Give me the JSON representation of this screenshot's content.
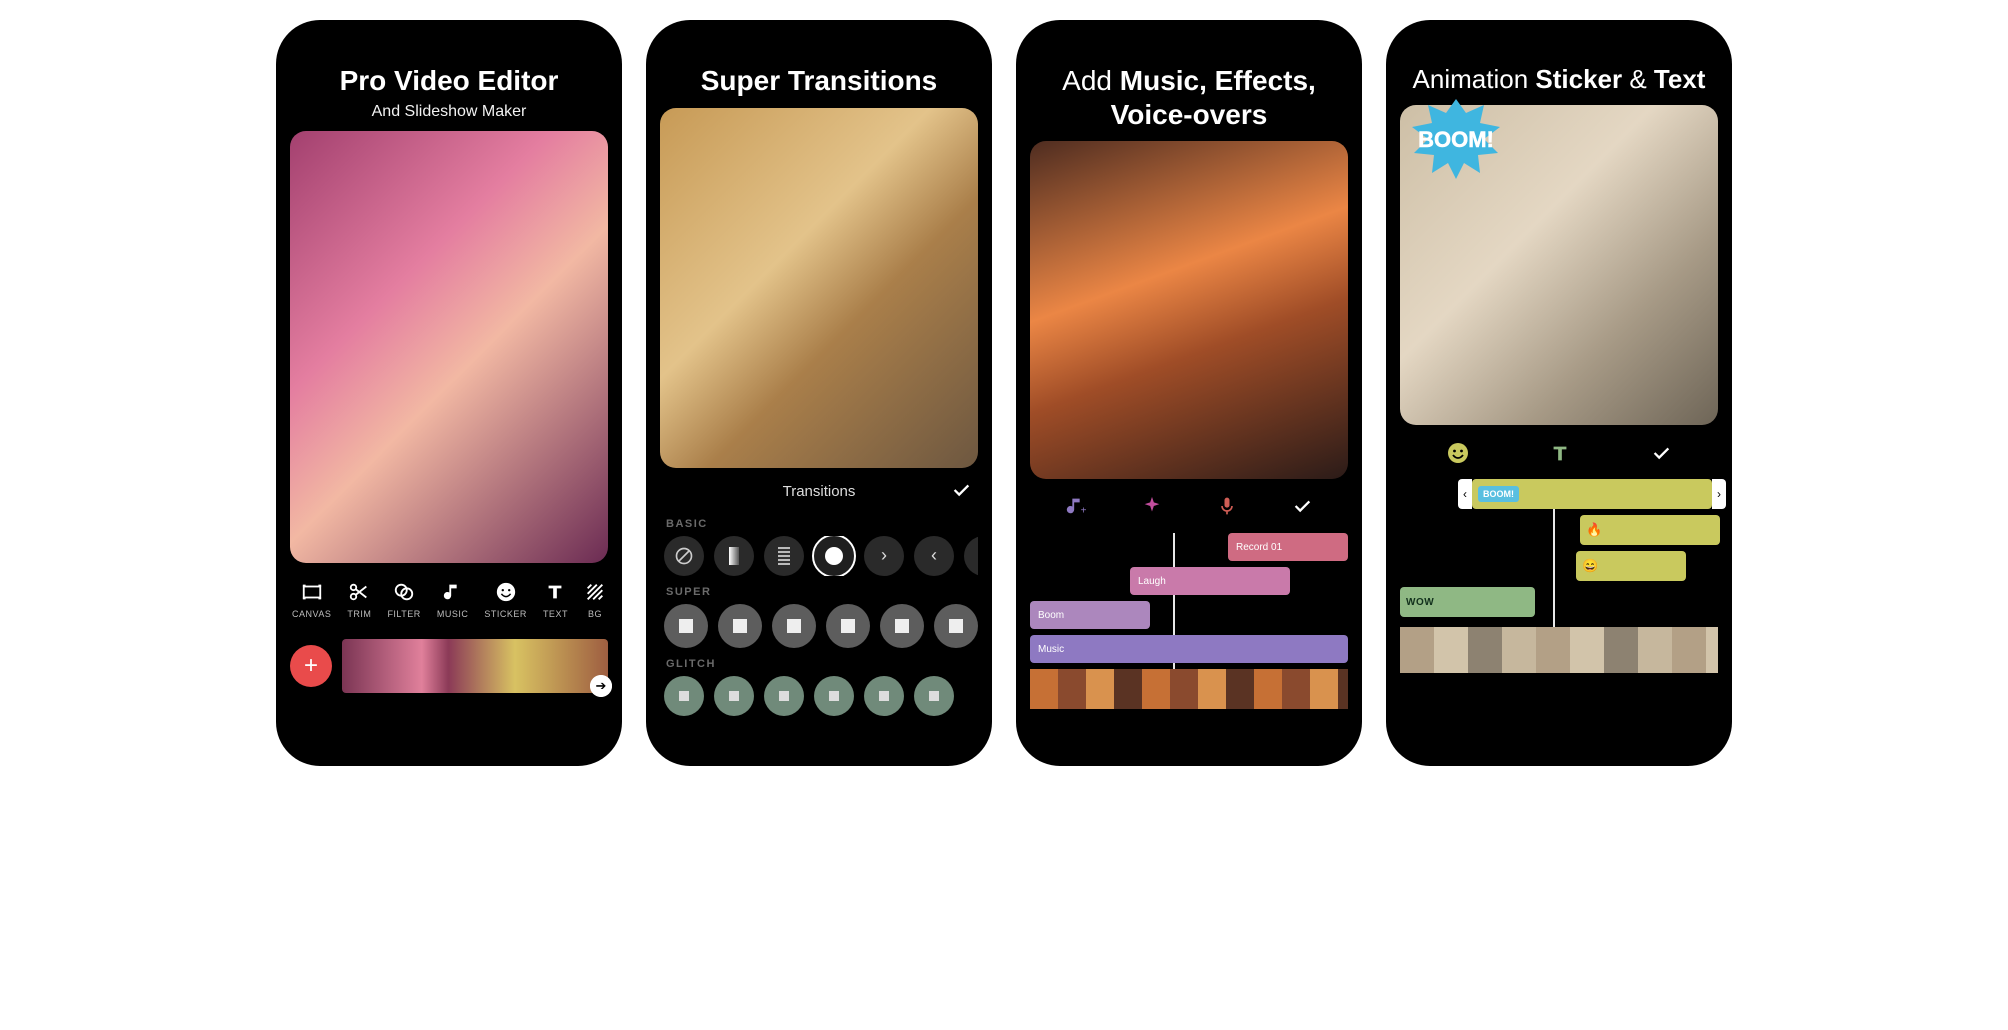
{
  "panels": [
    {
      "title_bold": "Pro Video Editor",
      "subtitle": "And Slideshow Maker",
      "tools": [
        {
          "name": "canvas",
          "label": "CANVAS"
        },
        {
          "name": "trim",
          "label": "TRIM"
        },
        {
          "name": "filter",
          "label": "FILTER"
        },
        {
          "name": "music",
          "label": "MUSIC"
        },
        {
          "name": "sticker",
          "label": "STICKER"
        },
        {
          "name": "text",
          "label": "TEXT"
        },
        {
          "name": "bg",
          "label": "BG"
        }
      ],
      "fab_label": "+"
    },
    {
      "title_bold": "Super Transitions",
      "transitions_header": "Transitions",
      "sections": [
        {
          "label": "BASIC"
        },
        {
          "label": "SUPER"
        },
        {
          "label": "GLITCH"
        }
      ]
    },
    {
      "title_pre": "Add ",
      "title_bold": "Music, Effects, Voice-overs",
      "strip_icons": [
        "music-note",
        "sparkle",
        "microphone",
        "check"
      ],
      "accent_colors": {
        "music-note": "#8e79c2",
        "sparkle": "#c24d9d",
        "microphone": "#d05d55",
        "check": "#ffffff"
      },
      "tracks": {
        "record": "Record 01",
        "laugh": "Laugh",
        "boom": "Boom",
        "music": "Music"
      }
    },
    {
      "title_pre": "Animation ",
      "title_bold1": "Sticker",
      "title_mid": " & ",
      "title_bold2": "Text",
      "sticker_text": "BOOM!",
      "strip_icons": [
        "smile",
        "text-t",
        "check"
      ],
      "clip_boom_badge": "BOOM!",
      "clip_wow": "WOW"
    }
  ]
}
